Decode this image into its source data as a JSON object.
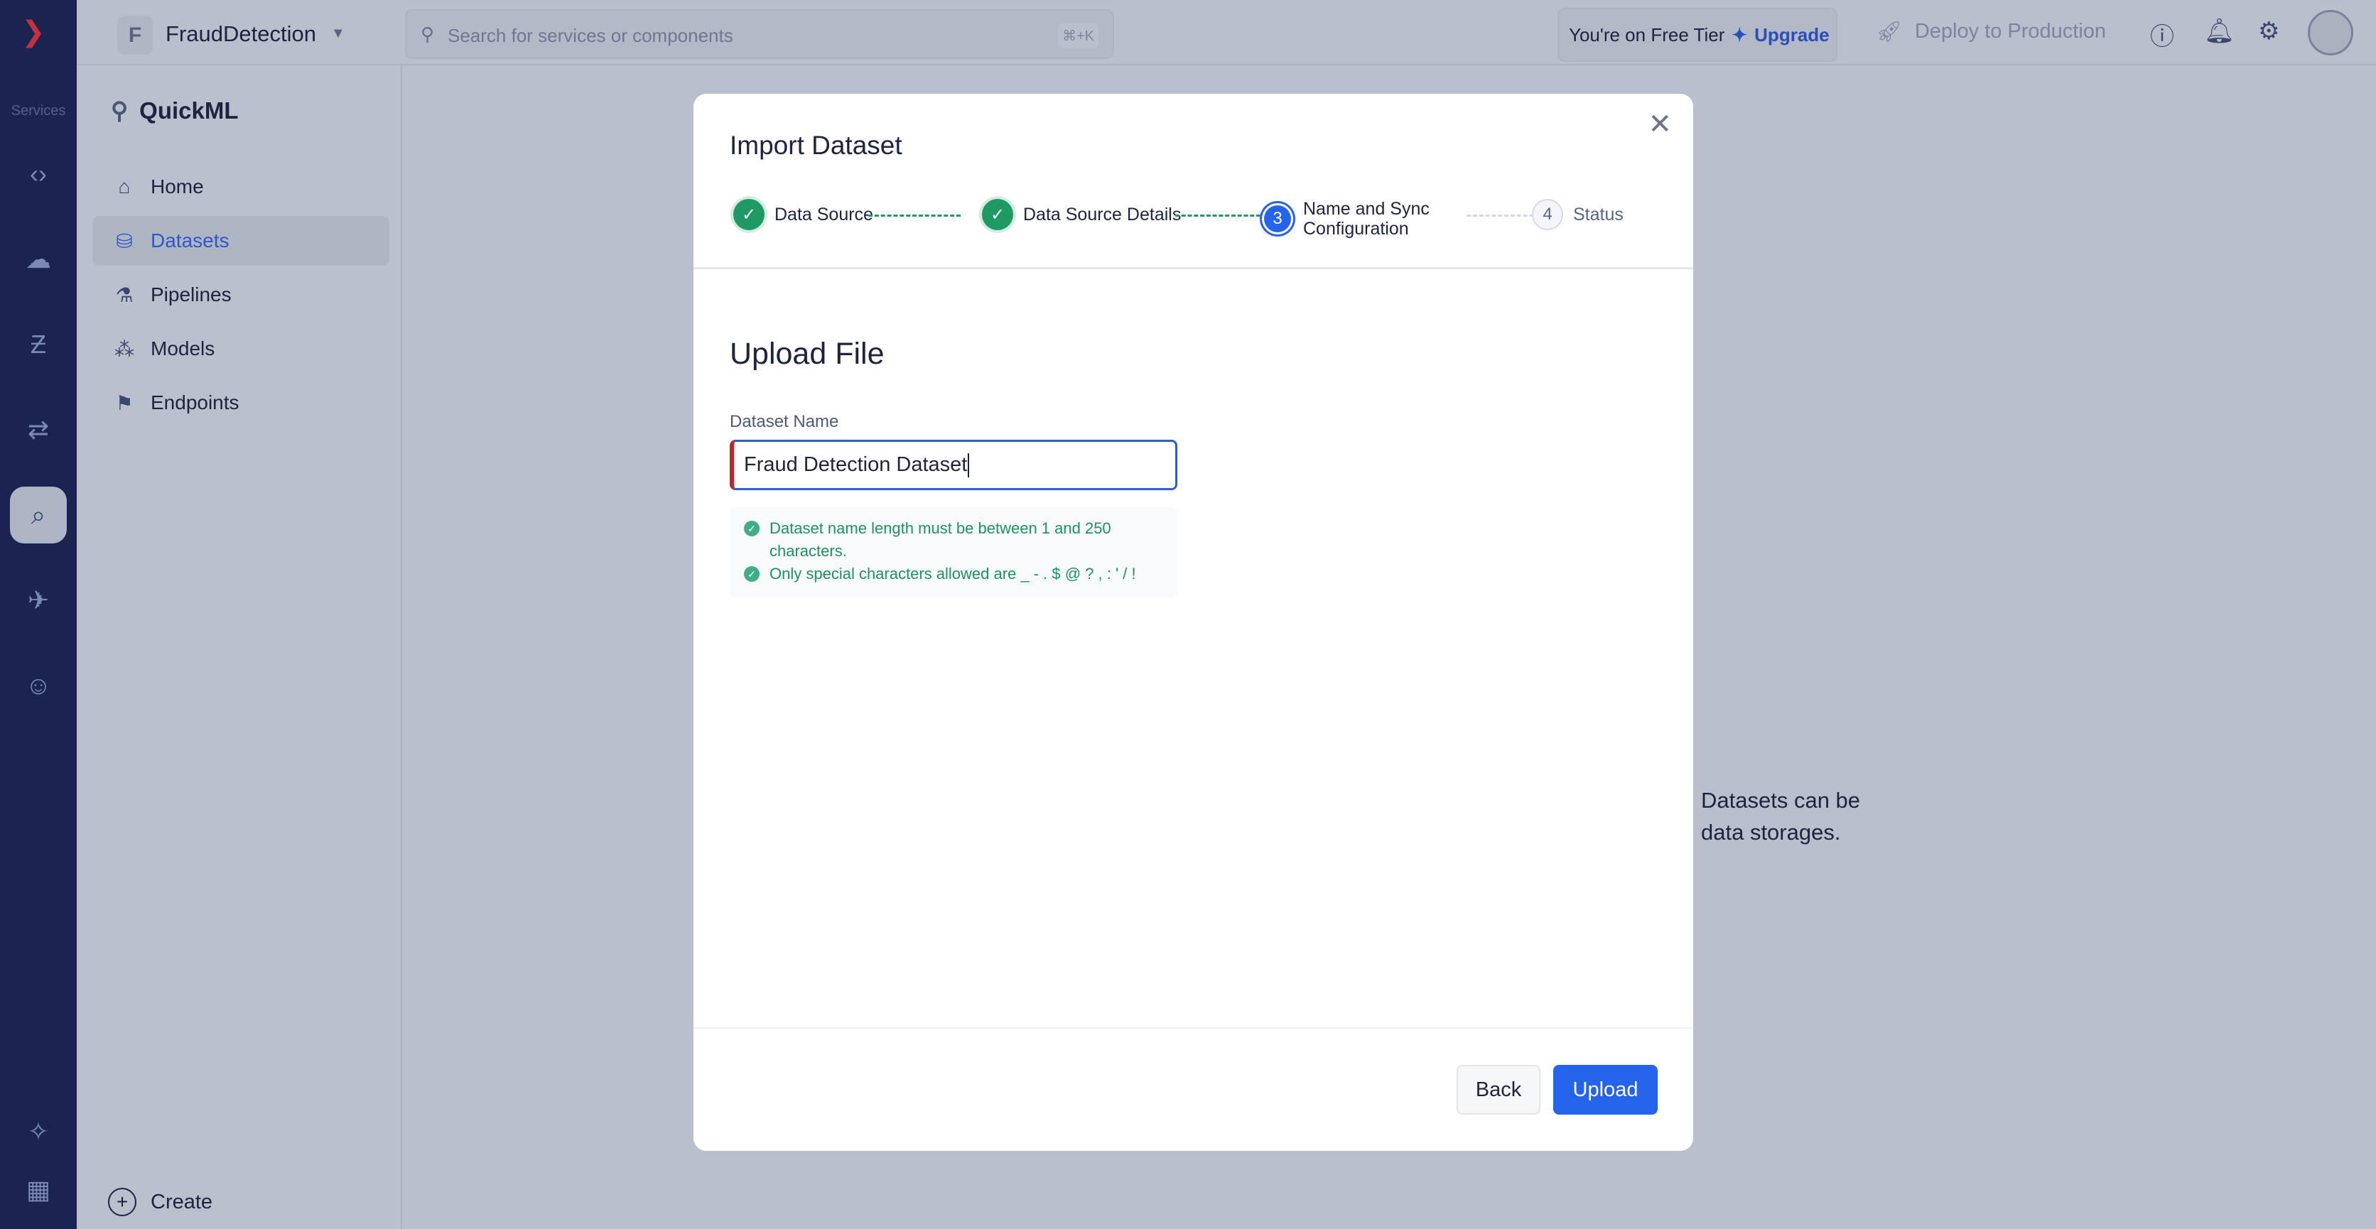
{
  "rail": {
    "services_label": "Services"
  },
  "topbar": {
    "workspace_initial": "F",
    "workspace_name": "FraudDetection",
    "search_placeholder": "Search for services or components",
    "search_shortcut": "⌘+K",
    "tier_text": "You're on Free Tier",
    "upgrade_label": "Upgrade",
    "deploy_label": "Deploy to Production"
  },
  "sidebar": {
    "brand": "QuickML",
    "items": [
      {
        "label": "Home",
        "icon": "⌂"
      },
      {
        "label": "Datasets",
        "icon": "⛁"
      },
      {
        "label": "Pipelines",
        "icon": "⚗"
      },
      {
        "label": "Models",
        "icon": "⁂"
      },
      {
        "label": "Endpoints",
        "icon": "⚑"
      }
    ],
    "create_label": "Create"
  },
  "background_text": {
    "line1": "Datasets can be",
    "line2": "data storages."
  },
  "modal": {
    "title": "Import Dataset",
    "steps": [
      {
        "label": "Data Source",
        "state": "done"
      },
      {
        "label": "Data Source Details",
        "state": "done"
      },
      {
        "number": "3",
        "label": "Name and Sync Configuration",
        "state": "current"
      },
      {
        "number": "4",
        "label": "Status",
        "state": "todo"
      }
    ],
    "section_title": "Upload File",
    "field_label": "Dataset Name",
    "field_value": "Fraud Detection Dataset",
    "validation": [
      "Dataset name length must be between 1 and 250 characters.",
      "Only special characters allowed are _ - . $ @ ? , : ' / !"
    ],
    "back_label": "Back",
    "upload_label": "Upload"
  },
  "colors": {
    "primary": "#2563eb",
    "success": "#1f9a64",
    "error": "#c4232e",
    "rail": "#1b2450"
  }
}
